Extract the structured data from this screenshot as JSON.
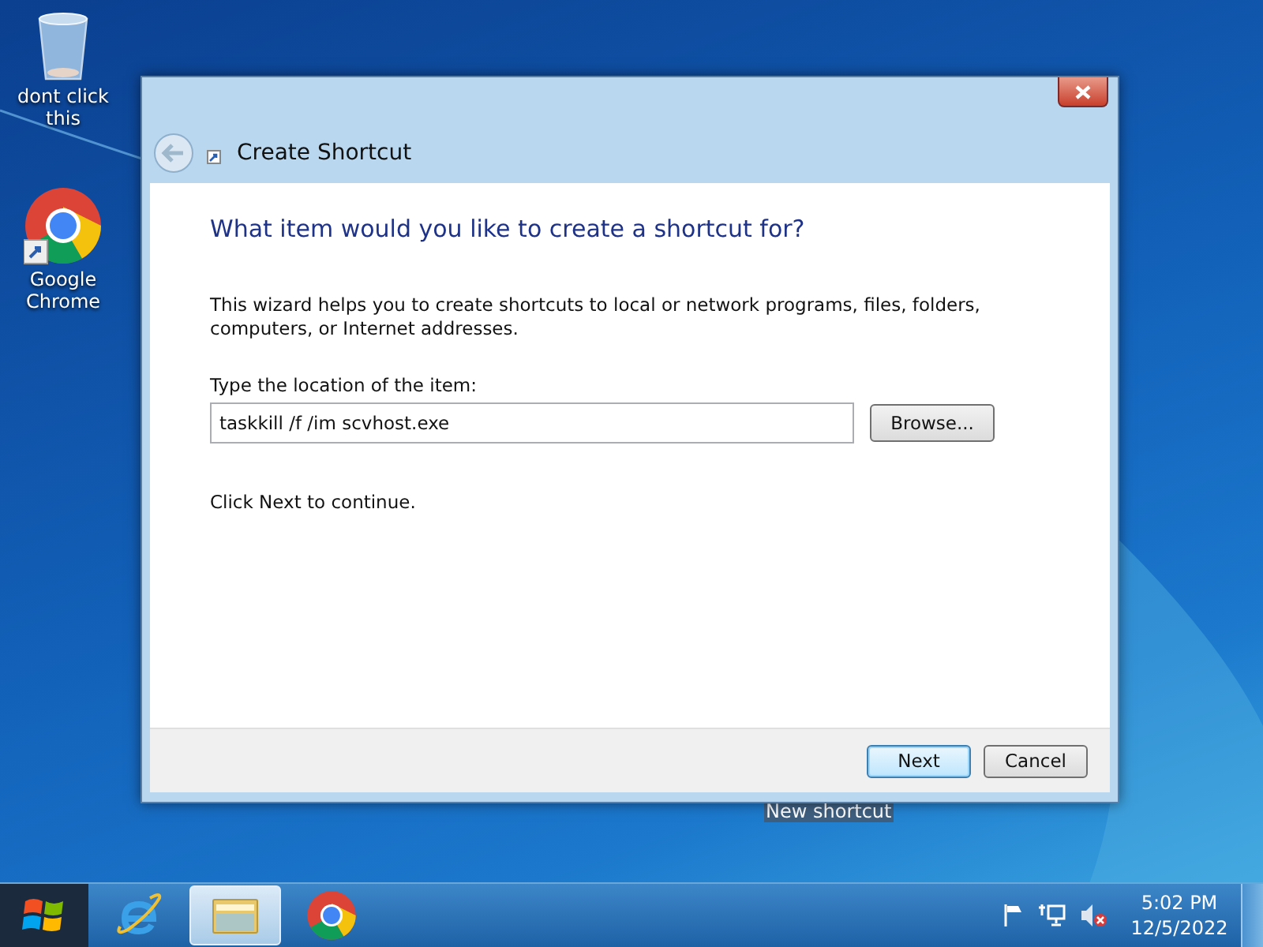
{
  "desktop_icons": [
    {
      "kind": "recycle-bin",
      "label": "dont click this"
    },
    {
      "kind": "chrome",
      "label": "Google Chrome"
    },
    {
      "kind": "hidden",
      "label": "New shortcut"
    }
  ],
  "window": {
    "title": "Create Shortcut",
    "heading": "What item would you like to create a shortcut for?",
    "description": "This wizard helps you to create shortcuts to local or network programs, files, folders, computers, or Internet addresses.",
    "field_label": "Type the location of the item:",
    "location_value": "taskkill /f /im scvhost.exe",
    "browse_button": "Browse...",
    "hint": "Click Next to continue.",
    "buttons": [
      {
        "label": "Next",
        "default": true
      },
      {
        "label": "Cancel",
        "default": false
      }
    ]
  },
  "taskbar": {
    "apps": [
      {
        "kind": "ie",
        "selected": false
      },
      {
        "kind": "explorer",
        "selected": true
      },
      {
        "kind": "chrome",
        "selected": false
      }
    ],
    "time": "5:02 PM",
    "date": "12/5/2022"
  }
}
